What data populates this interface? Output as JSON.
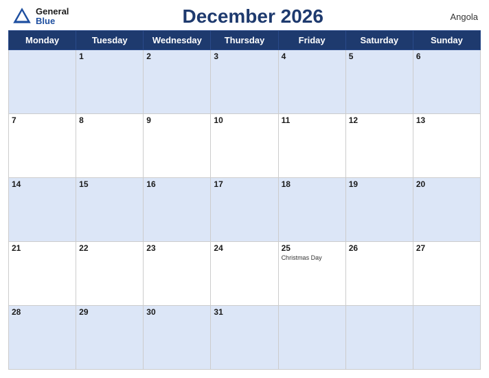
{
  "header": {
    "logo_general": "General",
    "logo_blue": "Blue",
    "title": "December 2026",
    "country": "Angola"
  },
  "days_of_week": [
    "Monday",
    "Tuesday",
    "Wednesday",
    "Thursday",
    "Friday",
    "Saturday",
    "Sunday"
  ],
  "weeks": [
    [
      {
        "day": "",
        "holiday": ""
      },
      {
        "day": "1",
        "holiday": ""
      },
      {
        "day": "2",
        "holiday": ""
      },
      {
        "day": "3",
        "holiday": ""
      },
      {
        "day": "4",
        "holiday": ""
      },
      {
        "day": "5",
        "holiday": ""
      },
      {
        "day": "6",
        "holiday": ""
      }
    ],
    [
      {
        "day": "7",
        "holiday": ""
      },
      {
        "day": "8",
        "holiday": ""
      },
      {
        "day": "9",
        "holiday": ""
      },
      {
        "day": "10",
        "holiday": ""
      },
      {
        "day": "11",
        "holiday": ""
      },
      {
        "day": "12",
        "holiday": ""
      },
      {
        "day": "13",
        "holiday": ""
      }
    ],
    [
      {
        "day": "14",
        "holiday": ""
      },
      {
        "day": "15",
        "holiday": ""
      },
      {
        "day": "16",
        "holiday": ""
      },
      {
        "day": "17",
        "holiday": ""
      },
      {
        "day": "18",
        "holiday": ""
      },
      {
        "day": "19",
        "holiday": ""
      },
      {
        "day": "20",
        "holiday": ""
      }
    ],
    [
      {
        "day": "21",
        "holiday": ""
      },
      {
        "day": "22",
        "holiday": ""
      },
      {
        "day": "23",
        "holiday": ""
      },
      {
        "day": "24",
        "holiday": ""
      },
      {
        "day": "25",
        "holiday": "Christmas Day"
      },
      {
        "day": "26",
        "holiday": ""
      },
      {
        "day": "27",
        "holiday": ""
      }
    ],
    [
      {
        "day": "28",
        "holiday": ""
      },
      {
        "day": "29",
        "holiday": ""
      },
      {
        "day": "30",
        "holiday": ""
      },
      {
        "day": "31",
        "holiday": ""
      },
      {
        "day": "",
        "holiday": ""
      },
      {
        "day": "",
        "holiday": ""
      },
      {
        "day": "",
        "holiday": ""
      }
    ]
  ]
}
